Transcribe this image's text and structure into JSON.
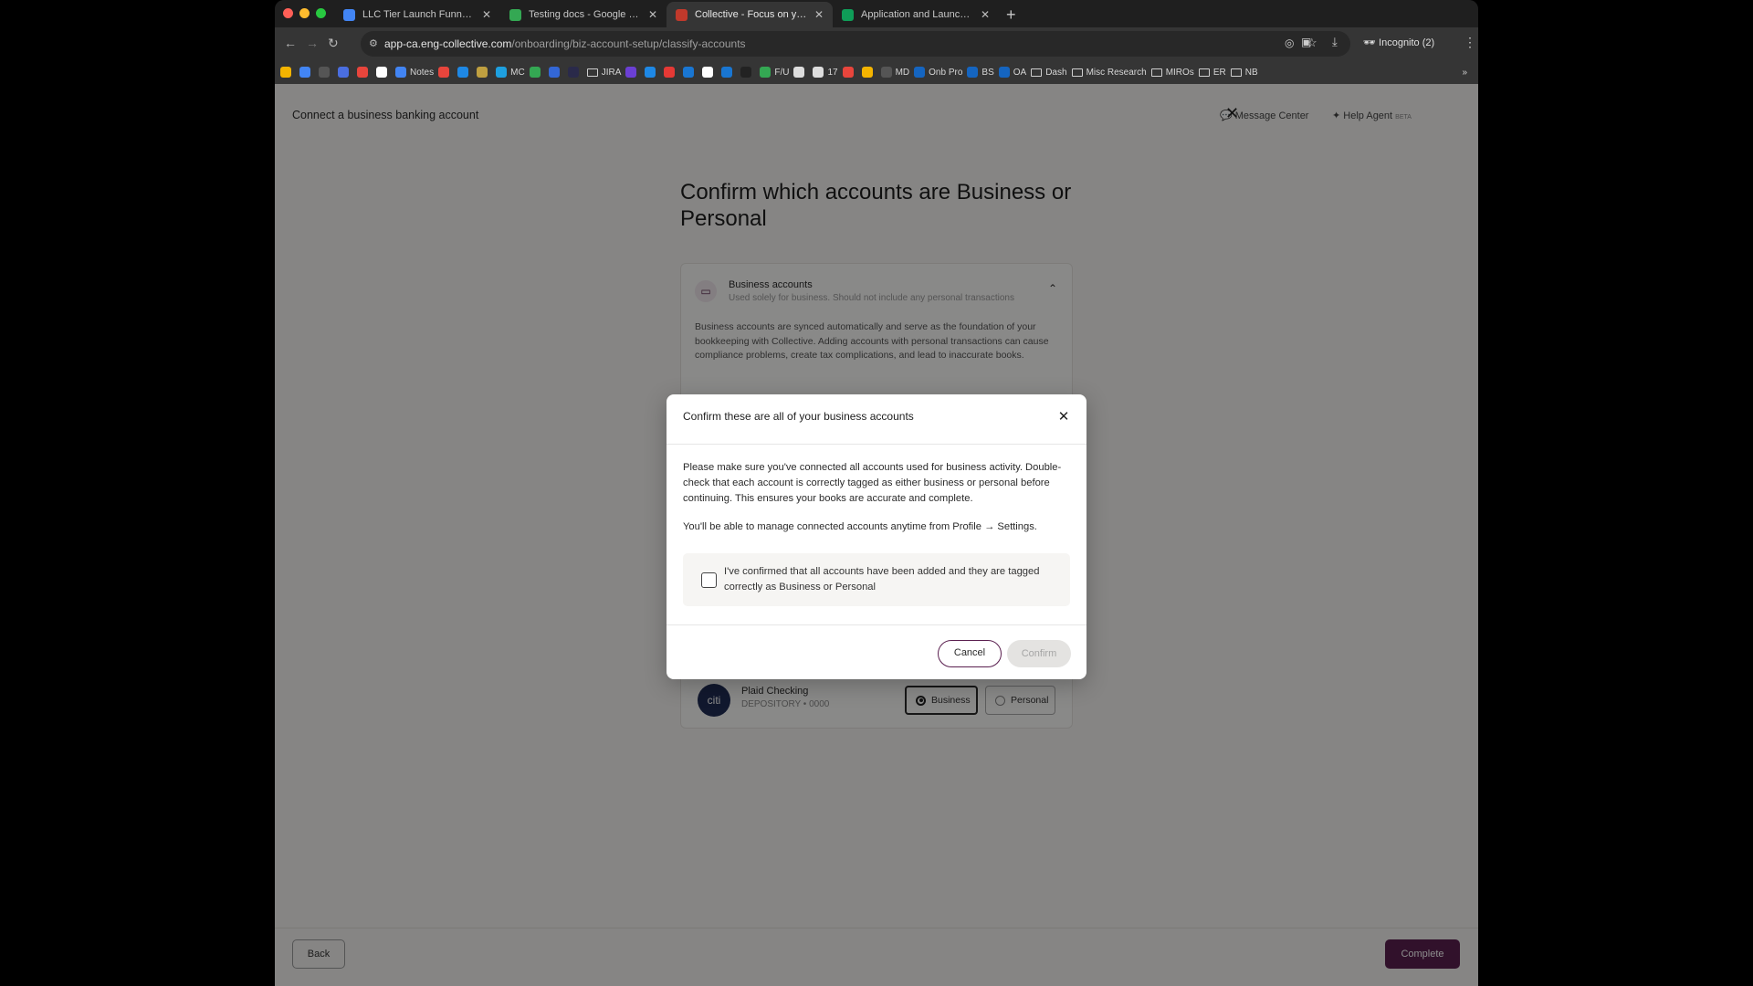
{
  "browser": {
    "tabs": [
      {
        "title": "LLC Tier Launch Funnel-App",
        "color": "#4285f4",
        "active": false
      },
      {
        "title": "Testing docs - Google Drive",
        "color": "#34a853",
        "active": false
      },
      {
        "title": "Collective - Focus on your pa",
        "color": "#c0392b",
        "active": true
      },
      {
        "title": "Application and Launchpad",
        "color": "#0f9d58",
        "active": false
      }
    ],
    "new_tab": "+",
    "url_domain": "app-ca.eng-collective.com",
    "url_path": "/onboarding/biz-account-setup/classify-accounts",
    "incognito_label": "Incognito (2)",
    "bookmarks": [
      {
        "label": "",
        "type": "icon",
        "color": "#f4b400"
      },
      {
        "label": "",
        "type": "icon",
        "color": "#4285f4"
      },
      {
        "label": "",
        "type": "icon",
        "color": "#555"
      },
      {
        "label": "",
        "type": "icon",
        "color": "#4a6ee0"
      },
      {
        "label": "",
        "type": "icon",
        "color": "#e8453c"
      },
      {
        "label": "",
        "type": "icon",
        "color": "#fff"
      },
      {
        "label": "Notes",
        "type": "icon",
        "color": "#4285f4"
      },
      {
        "label": "",
        "type": "icon",
        "color": "#e8453c"
      },
      {
        "label": "",
        "type": "icon",
        "color": "#1e88e5"
      },
      {
        "label": "",
        "type": "icon",
        "color": "#c0a040"
      },
      {
        "label": "MC",
        "type": "icon",
        "color": "#1ea0e0"
      },
      {
        "label": "",
        "type": "icon",
        "color": "#34a853"
      },
      {
        "label": "",
        "type": "icon",
        "color": "#3367d6"
      },
      {
        "label": "",
        "type": "icon",
        "color": "#2a2a4a"
      },
      {
        "label": "JIRA",
        "type": "folder"
      },
      {
        "label": "",
        "type": "icon",
        "color": "#6b3fd4"
      },
      {
        "label": "",
        "type": "icon",
        "color": "#1e88e5"
      },
      {
        "label": "",
        "type": "icon",
        "color": "#e53935"
      },
      {
        "label": "",
        "type": "icon",
        "color": "#1976d2"
      },
      {
        "label": "",
        "type": "icon",
        "color": "#fff"
      },
      {
        "label": "",
        "type": "icon",
        "color": "#1976d2"
      },
      {
        "label": "",
        "type": "icon",
        "color": "#222"
      },
      {
        "label": "F/U",
        "type": "icon",
        "color": "#34a853"
      },
      {
        "label": "",
        "type": "icon",
        "color": "#ddd"
      },
      {
        "label": "17",
        "type": "icon",
        "color": "#ddd"
      },
      {
        "label": "",
        "type": "icon",
        "color": "#e8453c"
      },
      {
        "label": "",
        "type": "icon",
        "color": "#f4b400"
      },
      {
        "label": "MD",
        "type": "icon",
        "color": "#555"
      },
      {
        "label": "Onb Pro",
        "type": "icon",
        "color": "#1565c0"
      },
      {
        "label": "BS",
        "type": "icon",
        "color": "#1565c0"
      },
      {
        "label": "OA",
        "type": "icon",
        "color": "#1565c0"
      },
      {
        "label": "Dash",
        "type": "folder"
      },
      {
        "label": "Misc Research",
        "type": "folder"
      },
      {
        "label": "MIROs",
        "type": "folder"
      },
      {
        "label": "ER",
        "type": "folder"
      },
      {
        "label": "NB",
        "type": "folder"
      }
    ],
    "more_bookmarks": "»"
  },
  "page": {
    "header_title": "Connect a business banking account",
    "message_center": "Message Center",
    "help_agent": "Help Agent",
    "help_agent_badge": "BETA",
    "title": "Confirm which accounts are Business or Personal",
    "business_section": {
      "title": "Business accounts",
      "subtitle": "Used solely for business. Should not include any personal transactions",
      "description": "Business accounts are synced automatically and serve as the foundation of your bookkeeping with Collective. Adding accounts with personal transactions can cause compliance problems, create tax complications, and lead to inaccurate books."
    },
    "account": {
      "logo_text": "citi",
      "name": "Plaid Checking",
      "type": "DEPOSITORY • 0000",
      "business_label": "Business",
      "personal_label": "Personal",
      "selected": "Business"
    },
    "back_label": "Back",
    "complete_label": "Complete"
  },
  "modal": {
    "title": "Confirm these are all of your business accounts",
    "body": "Please make sure you've connected all accounts used for business activity. Double-check that each account is correctly tagged as either business or personal before continuing. This ensures your books are accurate and complete.",
    "body2": "You'll be able to manage connected accounts anytime from Profile → Settings.",
    "checkbox_label": "I've confirmed that all accounts have been added and they are tagged correctly as Business or Personal",
    "checked": false,
    "cancel_label": "Cancel",
    "confirm_label": "Confirm"
  }
}
